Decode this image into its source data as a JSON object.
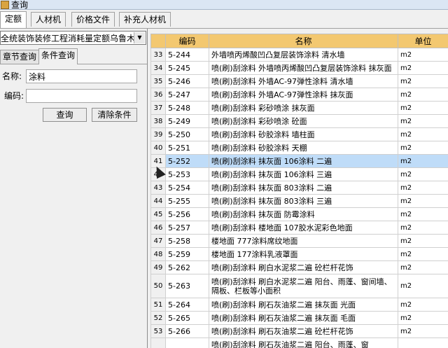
{
  "window": {
    "title": "查询"
  },
  "tabs": [
    {
      "label": "定额"
    },
    {
      "label": "人材机"
    },
    {
      "label": "价格文件"
    },
    {
      "label": "补充人材机"
    }
  ],
  "left": {
    "dropdown_value": "全统装饰装修工程消耗量定额乌鲁木",
    "subtabs": [
      {
        "label": "章节查询"
      },
      {
        "label": "条件查询"
      }
    ],
    "name_label": "名称:",
    "name_value": "涂料",
    "code_label": "编码:",
    "code_value": "",
    "query_button": "查询",
    "clear_button": "清除条件"
  },
  "grid": {
    "headers": {
      "code": "编码",
      "name": "名称",
      "unit": "单位"
    },
    "rows": [
      {
        "n": "33",
        "code": "5-244",
        "name": "外墙喷丙烯酸凹凸复层装饰涂料 清水墙",
        "unit": "m2"
      },
      {
        "n": "34",
        "code": "5-245",
        "name": "喷(刷)刮涂料 外墙喷丙烯酸凹凸复层装饰涂料 抹灰面",
        "unit": "m2"
      },
      {
        "n": "35",
        "code": "5-246",
        "name": "喷(刷)刮涂料 外墙AC-97弹性涂料 清水墙",
        "unit": "m2"
      },
      {
        "n": "36",
        "code": "5-247",
        "name": "喷(刷)刮涂料 外墙AC-97弹性涂料 抹灰面",
        "unit": "m2"
      },
      {
        "n": "37",
        "code": "5-248",
        "name": "喷(刷)刮涂料 彩砂喷涂 抹灰面",
        "unit": "m2"
      },
      {
        "n": "38",
        "code": "5-249",
        "name": "喷(刷)刮涂料 彩砂喷涂 砼面",
        "unit": "m2"
      },
      {
        "n": "39",
        "code": "5-250",
        "name": "喷(刷)刮涂料 砂胶涂料 墙柱面",
        "unit": "m2"
      },
      {
        "n": "40",
        "code": "5-251",
        "name": "喷(刷)刮涂料 砂胶涂料 天棚",
        "unit": "m2"
      },
      {
        "n": "41",
        "code": "5-252",
        "name": "喷(刷)刮涂料 抹灰面 106涂料 二遍",
        "unit": "m2"
      },
      {
        "n": "42",
        "code": "5-253",
        "name": "喷(刷)刮涂料 抹灰面 106涂料 三遍",
        "unit": "m2"
      },
      {
        "n": "43",
        "code": "5-254",
        "name": "喷(刷)刮涂料 抹灰面 803涂料 二遍",
        "unit": "m2"
      },
      {
        "n": "44",
        "code": "5-255",
        "name": "喷(刷)刮涂料 抹灰面 803涂料 三遍",
        "unit": "m2"
      },
      {
        "n": "45",
        "code": "5-256",
        "name": "喷(刷)刮涂料 抹灰面 防霉涂料",
        "unit": "m2"
      },
      {
        "n": "46",
        "code": "5-257",
        "name": "喷(刷)刮涂料 楼地面 107胶水泥彩色地面",
        "unit": "m2"
      },
      {
        "n": "47",
        "code": "5-258",
        "name": "楼地面 777涂料席纹地面",
        "unit": "m2"
      },
      {
        "n": "48",
        "code": "5-259",
        "name": "楼地面 177涂料乳液罩面",
        "unit": "m2"
      },
      {
        "n": "49",
        "code": "5-262",
        "name": "喷(刷)刮涂料 刷白水泥浆二遍 砼栏杆花饰",
        "unit": "m2"
      },
      {
        "n": "50",
        "code": "5-263",
        "name": "喷(刷)刮涂料 刷白水泥浆二遍 阳台、雨蓬、窗间墙、隔板、栏板等小面积",
        "unit": "m2"
      },
      {
        "n": "51",
        "code": "5-264",
        "name": "喷(刷)刮涂料 刷石灰油浆二遍 抹灰面 光面",
        "unit": "m2"
      },
      {
        "n": "52",
        "code": "5-265",
        "name": "喷(刷)刮涂料 刷石灰油浆二遍 抹灰面 毛面",
        "unit": "m2"
      },
      {
        "n": "53",
        "code": "5-266",
        "name": "喷(刷)刮涂料 刷石灰油浆二遍 砼栏杆花饰",
        "unit": "m2"
      },
      {
        "n": "",
        "code": "",
        "name": "喷(刷)刮涂料 刷石灰油浆二遍 阳台、雨蓬、窗",
        "unit": ""
      }
    ],
    "selected_index": 8
  }
}
